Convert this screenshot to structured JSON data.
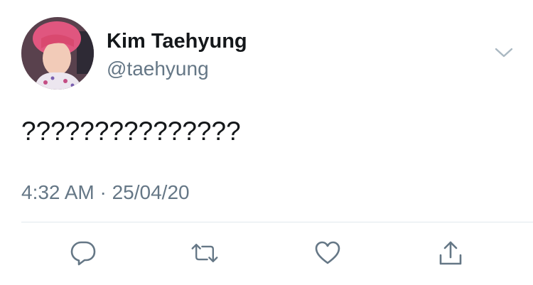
{
  "tweet": {
    "author_name": "Kim Taehyung",
    "author_handle": "@taehyung",
    "text": "???????????????",
    "timestamp": "4:32 AM · 25/04/20"
  },
  "icons": {
    "menu": "chevron-down-icon",
    "reply": "reply-icon",
    "retweet": "retweet-icon",
    "like": "heart-icon",
    "share": "share-icon"
  },
  "colors": {
    "text_primary": "#14171a",
    "text_secondary": "#657786",
    "icon": "#657786",
    "divider": "#e1e8ed",
    "background": "#ffffff"
  }
}
